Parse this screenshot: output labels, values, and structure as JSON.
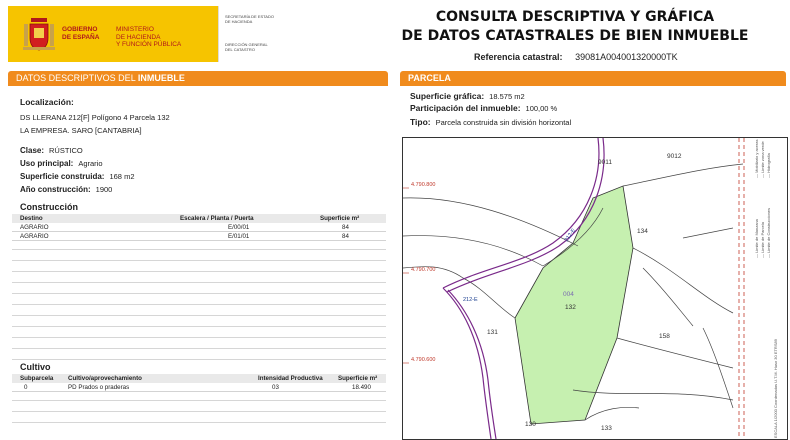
{
  "header": {
    "gov_lines": [
      "GOBIERNO",
      "DE ESPAÑA"
    ],
    "ministry_lines": [
      "MINISTERIO",
      "DE HACIENDA",
      "Y FUNCIÓN PÚBLICA"
    ],
    "secretaria_lines": [
      "SECRETARÍA DE ESTADO",
      "DE HACIENDA"
    ],
    "direccion_lines": [
      "DIRECCIÓN GENERAL",
      "DEL CATASTRO"
    ],
    "title_line1": "CONSULTA DESCRIPTIVA Y GRÁFICA",
    "title_line2": "DE DATOS CATASTRALES DE BIEN INMUEBLE",
    "ref_label": "Referencia catastral:",
    "ref_value": "39081A004001320000TK"
  },
  "left": {
    "bar_prefix": "DATOS DESCRIPTIVOS DEL ",
    "bar_bold": "INMUEBLE",
    "loc_label": "Localización:",
    "loc_line1": "DS LLERANA 212[F] Polígono 4 Parcela 132",
    "loc_line2": "LA EMPRESA. SARO [CANTABRIA]",
    "clase_label": "Clase:",
    "clase_value": "RÚSTICO",
    "uso_label": "Uso principal:",
    "uso_value": "Agrario",
    "sup_label": "Superficie construida:",
    "sup_value": "168 m2",
    "anio_label": "Año construcción:",
    "anio_value": "1900",
    "construccion": {
      "title": "Construcción",
      "headers": [
        "Destino",
        "Escalera / Planta / Puerta",
        "Superficie m²"
      ],
      "rows": [
        [
          "AGRARIO",
          "E/00/01",
          "84"
        ],
        [
          "AGRARIO",
          "E/01/01",
          "84"
        ]
      ]
    },
    "cultivo": {
      "title": "Cultivo",
      "headers": [
        "Subparcela",
        "Cultivo/aprovechamiento",
        "Intensidad Productiva",
        "Superficie m²"
      ],
      "rows": [
        [
          "0",
          "PD Prados o praderas",
          "03",
          "18.490"
        ]
      ]
    }
  },
  "right": {
    "bar_label": "PARCELA",
    "sup_label": "Superficie gráfica:",
    "sup_value": "18.575 m2",
    "part_label": "Participación del inmueble:",
    "part_value": "100,00 %",
    "tipo_label": "Tipo:",
    "tipo_value": "Parcela construida sin división horizontal",
    "map": {
      "coords": [
        "4.790.800",
        "4.790.700",
        "4.790.600"
      ],
      "parcel_labels": [
        "9011",
        "9012",
        "134",
        "131",
        "158",
        "130",
        "133",
        "004",
        "132"
      ],
      "road_labels": [
        "212-E",
        "212-E"
      ],
      "legend_lines": [
        "— Limite de Manzana",
        "— Limite de Parcela",
        "— Limite de Construcciones",
        "— Mobiliario y aceras",
        "— Limite zona verde",
        "— Hidrografía"
      ],
      "footer_text": "ESCALA 1/2000 Coordenadas U.T.M. Huso 30 ETRS89",
      "highlight_color": "#c6f0b0"
    }
  },
  "colors": {
    "accent": "#f08b1d",
    "gov_yellow": "#f6c400",
    "gov_red": "#b0181a"
  }
}
